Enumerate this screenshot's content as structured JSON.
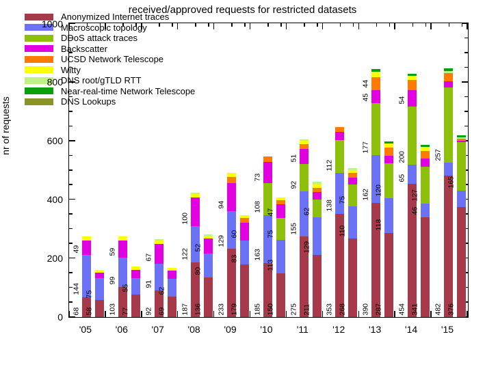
{
  "chart_data": {
    "type": "bar",
    "stacked": true,
    "title": "received/approved requests for restricted datasets",
    "xlabel": "",
    "ylabel": "nr of requests",
    "ylim": [
      0,
      1000
    ],
    "ytick_labels": [
      "0",
      "200",
      "400",
      "600",
      "800",
      "1000"
    ],
    "ytick_values": [
      0,
      200,
      400,
      600,
      800,
      1000
    ],
    "yminor_step": 50,
    "grid": false,
    "legend_position": "top-left inside",
    "xtick_labels": [
      "'05",
      "'06",
      "'07",
      "'08",
      "'09",
      "'10",
      "'11",
      "'12",
      "'13",
      "'14",
      "'15"
    ],
    "categories": [
      "'05 received",
      "'05 approved",
      "'06 received",
      "'06 approved",
      "'07 received",
      "'07 approved",
      "'08 received",
      "'08 approved",
      "'09 received",
      "'09 approved",
      "'10 received",
      "'10 approved",
      "'11 received",
      "'11 approved",
      "'12 received",
      "'12 approved",
      "'13 received",
      "'13 approved",
      "'14 received",
      "'14 approved",
      "'15 received",
      "'15 approved"
    ],
    "series": [
      {
        "name": "Anonymized Internet traces",
        "color": "#A63A4A",
        "values": [
          68,
          58,
          103,
          77,
          92,
          69,
          187,
          136,
          233,
          179,
          185,
          150,
          275,
          211,
          353,
          268,
          390,
          287,
          454,
          341,
          482,
          376
        ]
      },
      {
        "name": "Macroscopic topology",
        "color": "#6C72F5",
        "values": [
          144,
          75,
          99,
          55,
          91,
          62,
          122,
          80,
          129,
          83,
          163,
          113,
          155,
          129,
          138,
          110,
          162,
          118,
          65,
          46,
          44,
          56
        ]
      },
      {
        "name": "DDoS attack traces",
        "color": "#8DC00A",
        "values": [
          0,
          0,
          0,
          0,
          0,
          0,
          0,
          0,
          0,
          0,
          108,
          75,
          92,
          62,
          112,
          75,
          177,
          120,
          200,
          127,
          257,
          165
        ]
      },
      {
        "name": "Backscatter",
        "color": "#E000E0",
        "values": [
          49,
          18,
          59,
          29,
          67,
          28,
          100,
          52,
          94,
          60,
          73,
          47,
          51,
          25,
          28,
          22,
          45,
          25,
          54,
          26,
          22,
          5
        ]
      },
      {
        "name": "UCSD Network Telescope",
        "color": "#FF7A00",
        "values": [
          0,
          0,
          0,
          0,
          0,
          0,
          0,
          0,
          22,
          16,
          18,
          14,
          16,
          14,
          16,
          17,
          44,
          28,
          35,
          27,
          28,
          7
        ]
      },
      {
        "name": "Witty",
        "color": "#FFFF00",
        "values": [
          13,
          11,
          14,
          12,
          10,
          10,
          10,
          9,
          14,
          10,
          0,
          8,
          12,
          12,
          0,
          10,
          20,
          15,
          14,
          13,
          0,
          0
        ]
      },
      {
        "name": "DNS root/gTLD RTT",
        "color": "#BFF08A",
        "values": [
          0,
          0,
          0,
          0,
          6,
          0,
          5,
          5,
          0,
          0,
          0,
          0,
          5,
          8,
          0,
          6,
          0,
          0,
          0,
          0,
          6,
          4
        ]
      },
      {
        "name": "Near-real-time Network Telescope",
        "color": "#0B9F0B",
        "values": [
          0,
          0,
          0,
          0,
          0,
          0,
          0,
          0,
          0,
          0,
          0,
          0,
          0,
          0,
          0,
          0,
          8,
          7,
          9,
          8,
          9,
          6
        ]
      },
      {
        "name": "DNS Lookups",
        "color": "#8A9326",
        "values": [
          0,
          0,
          0,
          0,
          0,
          0,
          0,
          0,
          0,
          0,
          0,
          0,
          0,
          0,
          0,
          0,
          0,
          0,
          0,
          0,
          0,
          0
        ]
      }
    ],
    "bar_value_labels": [
      [
        [
          "Anonymized Internet traces",
          "68"
        ],
        [
          "Macroscopic topology",
          "144"
        ],
        [
          "Backscatter",
          "49"
        ]
      ],
      [
        [
          "Anonymized Internet traces",
          "58"
        ],
        [
          "Macroscopic topology",
          "75"
        ]
      ],
      [
        [
          "Anonymized Internet traces",
          "103"
        ],
        [
          "Macroscopic topology",
          "99"
        ],
        [
          "Backscatter",
          "59"
        ]
      ],
      [
        [
          "Anonymized Internet traces",
          "77"
        ],
        [
          "Macroscopic topology",
          "55"
        ]
      ],
      [
        [
          "Anonymized Internet traces",
          "92"
        ],
        [
          "Macroscopic topology",
          "91"
        ],
        [
          "Backscatter",
          "67"
        ]
      ],
      [
        [
          "Anonymized Internet traces",
          "69"
        ],
        [
          "Macroscopic topology",
          "62"
        ]
      ],
      [
        [
          "Anonymized Internet traces",
          "187"
        ],
        [
          "Macroscopic topology",
          "122"
        ],
        [
          "Backscatter",
          "100"
        ]
      ],
      [
        [
          "Anonymized Internet traces",
          "136"
        ],
        [
          "Macroscopic topology",
          "80"
        ],
        [
          "Backscatter",
          "52"
        ]
      ],
      [
        [
          "Anonymized Internet traces",
          "233"
        ],
        [
          "Macroscopic topology",
          "129"
        ],
        [
          "Backscatter",
          "94"
        ]
      ],
      [
        [
          "Anonymized Internet traces",
          "179"
        ],
        [
          "Macroscopic topology",
          "83"
        ],
        [
          "Backscatter",
          "60"
        ]
      ],
      [
        [
          "Anonymized Internet traces",
          "185"
        ],
        [
          "Macroscopic topology",
          "163"
        ],
        [
          "DDoS attack traces",
          "108"
        ],
        [
          "Backscatter",
          "73"
        ]
      ],
      [
        [
          "Anonymized Internet traces",
          "150"
        ],
        [
          "Macroscopic topology",
          "113"
        ],
        [
          "DDoS attack traces",
          "75"
        ],
        [
          "Backscatter",
          "47"
        ]
      ],
      [
        [
          "Anonymized Internet traces",
          "275"
        ],
        [
          "Macroscopic topology",
          "155"
        ],
        [
          "DDoS attack traces",
          "92"
        ],
        [
          "Backscatter",
          "51"
        ]
      ],
      [
        [
          "Anonymized Internet traces",
          "211"
        ],
        [
          "Macroscopic topology",
          "129"
        ],
        [
          "DDoS attack traces",
          "62"
        ]
      ],
      [
        [
          "Anonymized Internet traces",
          "353"
        ],
        [
          "Macroscopic topology",
          "138"
        ],
        [
          "DDoS attack traces",
          "112"
        ]
      ],
      [
        [
          "Anonymized Internet traces",
          "268"
        ],
        [
          "Macroscopic topology",
          "110"
        ],
        [
          "DDoS attack traces",
          "75"
        ]
      ],
      [
        [
          "Anonymized Internet traces",
          "390"
        ],
        [
          "Macroscopic topology",
          "162"
        ],
        [
          "DDoS attack traces",
          "177"
        ],
        [
          "Backscatter",
          "45"
        ],
        [
          "UCSD Network Telescope",
          "44"
        ]
      ],
      [
        [
          "Anonymized Internet traces",
          "287"
        ],
        [
          "Macroscopic topology",
          "118"
        ],
        [
          "DDoS attack traces",
          "120"
        ]
      ],
      [
        [
          "Anonymized Internet traces",
          "454"
        ],
        [
          "Macroscopic topology",
          "65"
        ],
        [
          "DDoS attack traces",
          "200"
        ],
        [
          "Backscatter",
          "54"
        ]
      ],
      [
        [
          "Anonymized Internet traces",
          "341"
        ],
        [
          "Macroscopic topology",
          "46"
        ],
        [
          "DDoS attack traces",
          "127"
        ]
      ],
      [
        [
          "Anonymized Internet traces",
          "482"
        ],
        [
          "DDoS attack traces",
          "257"
        ]
      ],
      [
        [
          "Anonymized Internet traces",
          "376"
        ],
        [
          "DDoS attack traces",
          "165"
        ]
      ]
    ]
  },
  "legend": {
    "items": [
      {
        "label": "Anonymized Internet traces",
        "color": "#A63A4A"
      },
      {
        "label": "Macroscopic topology",
        "color": "#6C72F5"
      },
      {
        "label": "DDoS attack traces",
        "color": "#8DC00A"
      },
      {
        "label": "Backscatter",
        "color": "#E000E0"
      },
      {
        "label": "UCSD Network Telescope",
        "color": "#FF7A00"
      },
      {
        "label": "Witty",
        "color": "#FFFF00"
      },
      {
        "label": "DNS root/gTLD RTT",
        "color": "#BFF08A"
      },
      {
        "label": "Near-real-time Network Telescope",
        "color": "#0B9F0B"
      },
      {
        "label": "DNS Lookups",
        "color": "#8A9326"
      }
    ]
  }
}
